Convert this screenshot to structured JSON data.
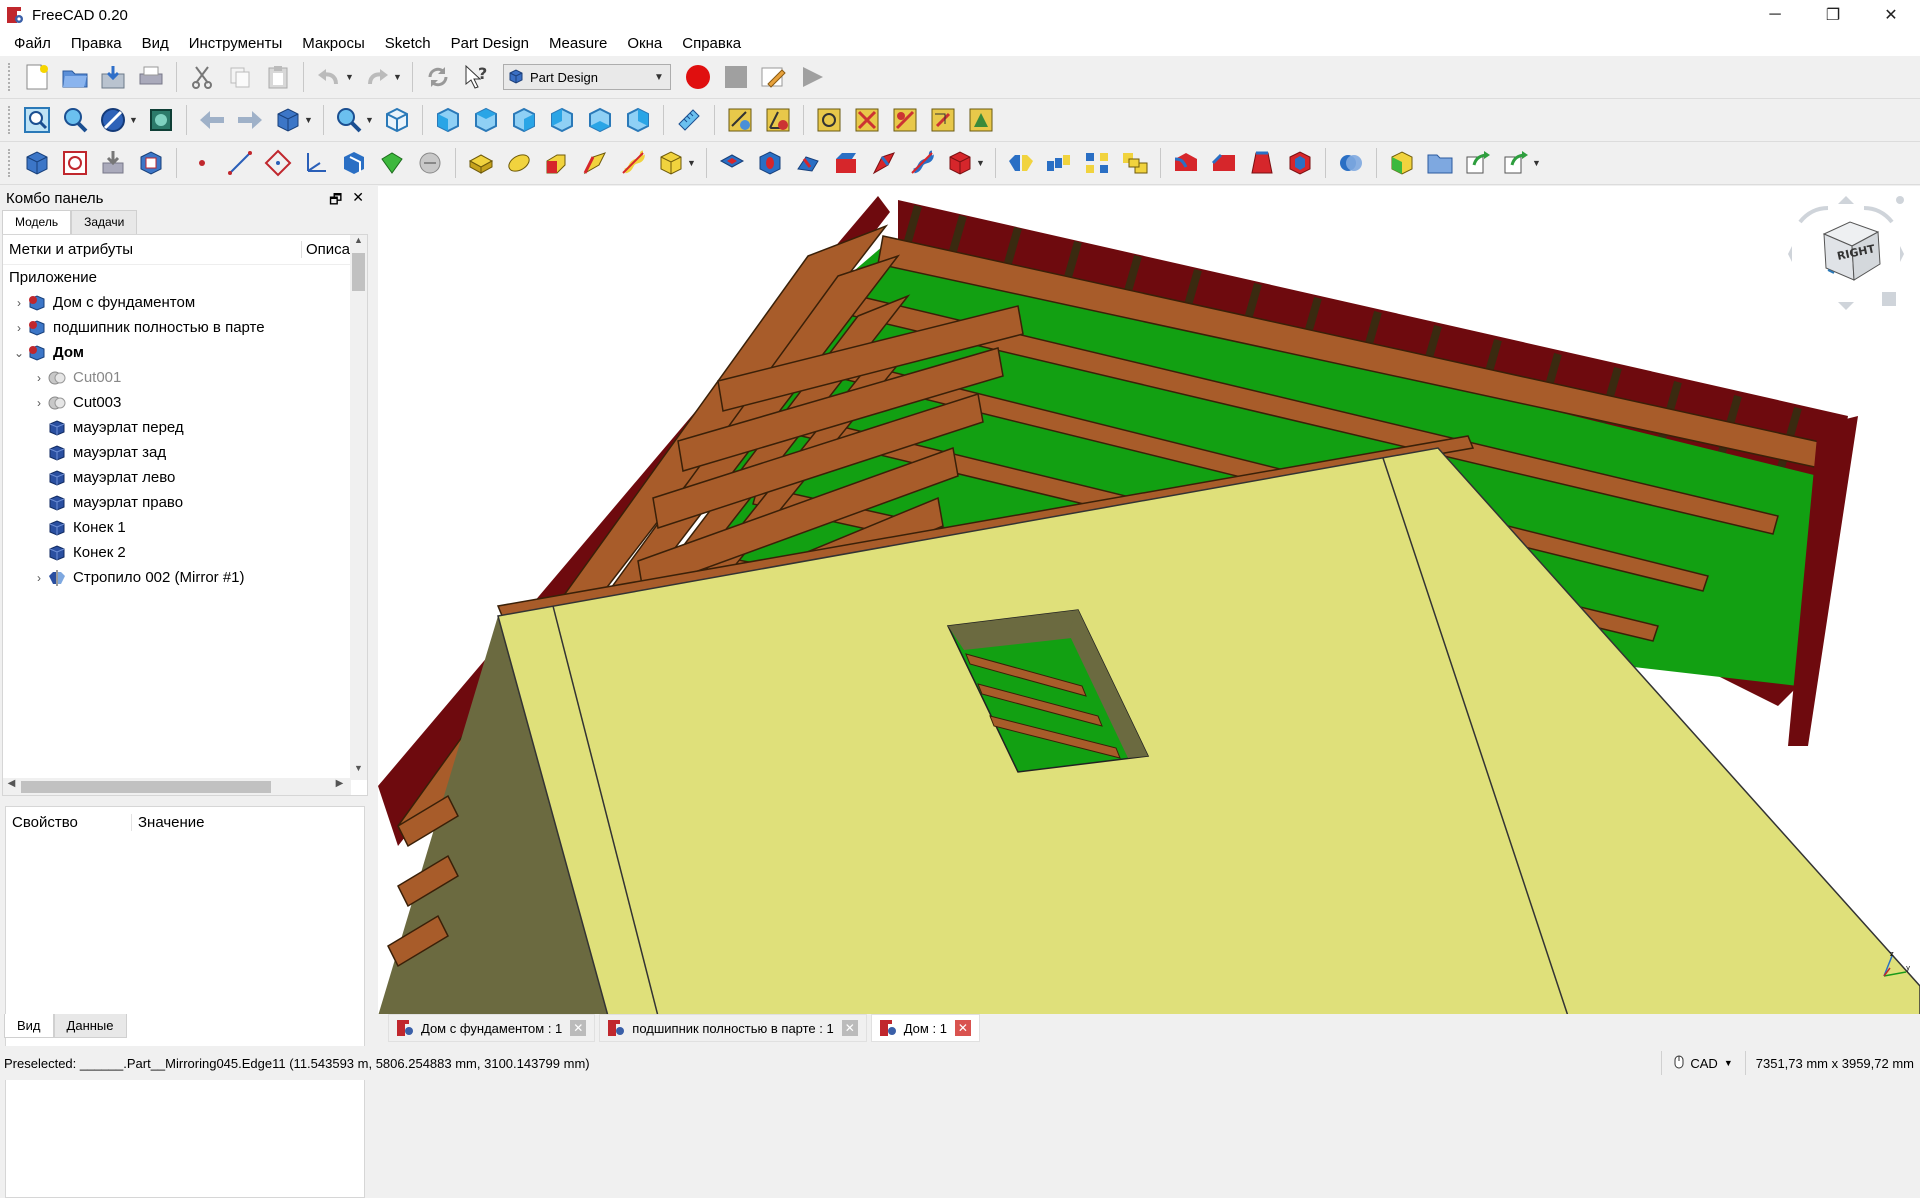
{
  "window": {
    "title": "FreeCAD 0.20",
    "minimize": "─",
    "maximize": "❐",
    "close": "✕"
  },
  "menu": [
    "Файл",
    "Правка",
    "Вид",
    "Инструменты",
    "Макросы",
    "Sketch",
    "Part Design",
    "Measure",
    "Окна",
    "Справка"
  ],
  "toolbar": {
    "workbench": "Part Design"
  },
  "combo": {
    "title": "Комбо панель",
    "tabs": [
      "Модель",
      "Задачи"
    ],
    "tree_headers": [
      "Метки и атрибуты",
      "Описа"
    ],
    "tree_root": "Приложение",
    "tree_items": [
      {
        "label": "Дом с фундаментом",
        "arrow": "›",
        "icon": "document-icon",
        "indent": 0,
        "style": ""
      },
      {
        "label": "подшипник полностью в парте",
        "arrow": "›",
        "icon": "document-icon",
        "indent": 0,
        "style": ""
      },
      {
        "label": "Дом",
        "arrow": "⌄",
        "icon": "document-icon",
        "indent": 0,
        "style": "bold"
      },
      {
        "label": "Cut001",
        "arrow": "›",
        "icon": "cut-icon",
        "indent": 1,
        "style": "grey"
      },
      {
        "label": "Cut003",
        "arrow": "›",
        "icon": "cut-icon",
        "indent": 1,
        "style": ""
      },
      {
        "label": "мауэрлат перед",
        "arrow": "",
        "icon": "part-box-icon",
        "indent": 1,
        "style": ""
      },
      {
        "label": "мауэрлат зад",
        "arrow": "",
        "icon": "part-box-icon",
        "indent": 1,
        "style": ""
      },
      {
        "label": "мауэрлат лево",
        "arrow": "",
        "icon": "part-box-icon",
        "indent": 1,
        "style": ""
      },
      {
        "label": "мауэрлат право",
        "arrow": "",
        "icon": "part-box-icon",
        "indent": 1,
        "style": ""
      },
      {
        "label": "Конек 1",
        "arrow": "",
        "icon": "part-box-icon",
        "indent": 1,
        "style": ""
      },
      {
        "label": "Конек 2",
        "arrow": "",
        "icon": "part-box-icon",
        "indent": 1,
        "style": ""
      },
      {
        "label": "Стропило 002 (Mirror #1)",
        "arrow": "›",
        "icon": "mirror-icon",
        "indent": 1,
        "style": ""
      }
    ],
    "prop_headers": [
      "Свойство",
      "Значение"
    ],
    "bottom_tabs": [
      "Вид",
      "Данные"
    ]
  },
  "navcube": {
    "face": "RIGHT"
  },
  "doc_tabs": [
    {
      "label": "Дом с фундаментом : 1",
      "active": false
    },
    {
      "label": "подшипник полностью в парте : 1",
      "active": false
    },
    {
      "label": "Дом : 1",
      "active": true
    }
  ],
  "status": {
    "message": "Preselected: ______.Part__Mirroring045.Edge11 (11.543593 m, 5806.254883 mm, 3100.143799 mm)",
    "nav_style": "CAD",
    "dimensions": "7351,73 mm x 3959,72 mm"
  },
  "colors": {
    "roof_red": "#6e0a0e",
    "wood": "#a85c2a",
    "insulation_green": "#12a012",
    "wall": "#dfe07a",
    "wall_side": "#6b6a40"
  }
}
